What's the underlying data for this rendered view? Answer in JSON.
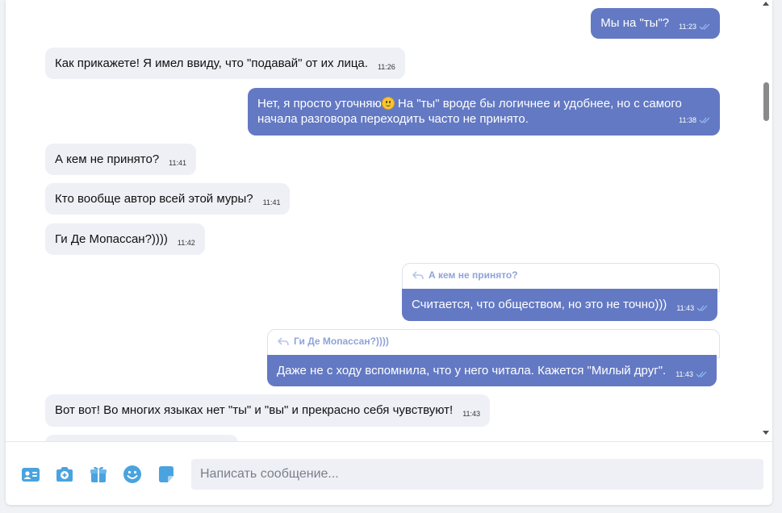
{
  "messages": [
    {
      "dir": "out",
      "text": "Мы на \"ты\"?",
      "time": "11:23"
    },
    {
      "dir": "in",
      "text": "Как прикажете! Я имел ввиду, что \"подавай\" от их лица.",
      "time": "11:26"
    },
    {
      "dir": "out",
      "line1": "Нет, я просто уточняю",
      "line1b": " На \"ты\" вроде бы логичнее и удобнее, но с самого",
      "line2": "начала разговора переходить часто не принято.",
      "time": "11:38"
    },
    {
      "dir": "in",
      "text": "А кем не принято?",
      "time": "11:41"
    },
    {
      "dir": "in",
      "text": "Кто вообще автор всей этой муры?",
      "time": "11:41"
    },
    {
      "dir": "in",
      "text": "Ги Де Мопассан?))))",
      "time": "11:42"
    },
    {
      "dir": "out",
      "reply": "А кем не принято?",
      "text": "Считается, что обществом, но это не точно)))",
      "time": "11:43"
    },
    {
      "dir": "out",
      "reply": "Ги Де Мопассан?))))",
      "text": "Даже не с ходу вспомнила, что у него читала. Кажется \"Милый друг\".",
      "time": "11:43"
    },
    {
      "dir": "in",
      "text": "Вот вот! Во многих языках нет \"ты\" и \"вы\" и прекрасно себя чувствуют!",
      "time": "11:43"
    }
  ],
  "composer": {
    "placeholder": "Написать сообщение...",
    "icons": [
      "contact-card-icon",
      "camera-icon",
      "gift-icon",
      "emoji-icon",
      "sticker-icon"
    ]
  },
  "colors": {
    "outgoing": "#6379c3",
    "incoming": "#eef0f6",
    "accent": "#4aa3df"
  }
}
